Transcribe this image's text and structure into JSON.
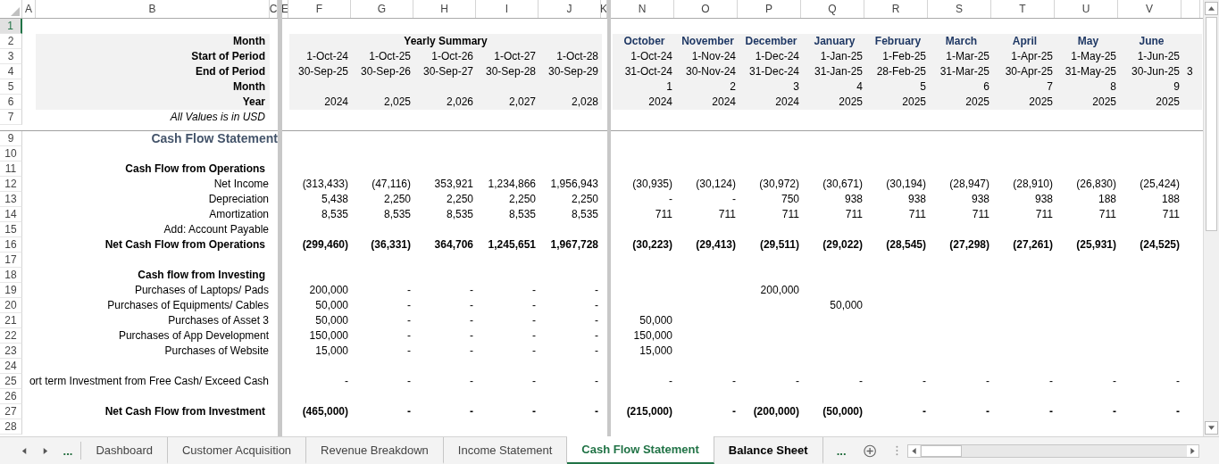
{
  "column_headers": [
    "A",
    "B",
    "C",
    "E",
    "F",
    "G",
    "H",
    "I",
    "J",
    "K",
    "N",
    "O",
    "P",
    "Q",
    "R",
    "S",
    "T",
    "U",
    "V"
  ],
  "rows": [
    {
      "number": "1",
      "kind": "blank",
      "selected": true
    },
    {
      "number": "2",
      "kind": "band_title",
      "selected": false,
      "label": "Month",
      "summary_title": "Yearly Summary",
      "monthly": [
        "October",
        "November",
        "December",
        "January",
        "February",
        "March",
        "April",
        "May",
        "June"
      ]
    },
    {
      "number": "3",
      "kind": "band",
      "selected": false,
      "label": "Start of Period",
      "summary": [
        "1-Oct-24",
        "1-Oct-25",
        "1-Oct-26",
        "1-Oct-27",
        "1-Oct-28"
      ],
      "monthly": [
        "1-Oct-24",
        "1-Nov-24",
        "1-Dec-24",
        "1-Jan-25",
        "1-Feb-25",
        "1-Mar-25",
        "1-Apr-25",
        "1-May-25",
        "1-Jun-25"
      ]
    },
    {
      "number": "4",
      "kind": "band",
      "selected": false,
      "label": "End of Period",
      "summary": [
        "30-Sep-25",
        "30-Sep-26",
        "30-Sep-27",
        "30-Sep-28",
        "30-Sep-29"
      ],
      "monthly": [
        "31-Oct-24",
        "30-Nov-24",
        "31-Dec-24",
        "31-Jan-25",
        "28-Feb-25",
        "31-Mar-25",
        "30-Apr-25",
        "31-May-25",
        "30-Jun-25"
      ],
      "cut": "3"
    },
    {
      "number": "5",
      "kind": "band",
      "selected": false,
      "label": "Month",
      "monthly": [
        "1",
        "2",
        "3",
        "4",
        "5",
        "6",
        "7",
        "8",
        "9"
      ]
    },
    {
      "number": "6",
      "kind": "band",
      "selected": false,
      "label": "Year",
      "summary": [
        "2024",
        "2,025",
        "2,026",
        "2,027",
        "2,028"
      ],
      "monthly": [
        "2024",
        "2024",
        "2024",
        "2025",
        "2025",
        "2025",
        "2025",
        "2025",
        "2025"
      ]
    },
    {
      "number": "7",
      "kind": "note",
      "selected": false,
      "label": "All Values is in USD"
    },
    {
      "number": "9",
      "kind": "section",
      "selected": false,
      "label": "Cash Flow Statement"
    },
    {
      "number": "10",
      "kind": "blank",
      "selected": false
    },
    {
      "number": "11",
      "kind": "heading",
      "selected": false,
      "label": "Cash Flow from Operations"
    },
    {
      "number": "12",
      "kind": "item",
      "selected": false,
      "label": "Net Income",
      "summary": [
        "(313,433)",
        "(47,116)",
        "353,921",
        "1,234,866",
        "1,956,943"
      ],
      "monthly": [
        "(30,935)",
        "(30,124)",
        "(30,972)",
        "(30,671)",
        "(30,194)",
        "(28,947)",
        "(28,910)",
        "(26,830)",
        "(25,424)"
      ]
    },
    {
      "number": "13",
      "kind": "item",
      "selected": false,
      "label": "Depreciation",
      "summary": [
        "5,438",
        "2,250",
        "2,250",
        "2,250",
        "2,250"
      ],
      "monthly": [
        "-",
        "-",
        "750",
        "938",
        "938",
        "938",
        "938",
        "188",
        "188"
      ]
    },
    {
      "number": "14",
      "kind": "item",
      "selected": false,
      "label": "Amortization",
      "summary": [
        "8,535",
        "8,535",
        "8,535",
        "8,535",
        "8,535"
      ],
      "monthly": [
        "711",
        "711",
        "711",
        "711",
        "711",
        "711",
        "711",
        "711",
        "711"
      ]
    },
    {
      "number": "15",
      "kind": "item",
      "selected": false,
      "label": "Add: Account Payable"
    },
    {
      "number": "16",
      "kind": "total",
      "selected": false,
      "label": "Net Cash Flow from Operations",
      "summary": [
        "(299,460)",
        "(36,331)",
        "364,706",
        "1,245,651",
        "1,967,728"
      ],
      "monthly": [
        "(30,223)",
        "(29,413)",
        "(29,511)",
        "(29,022)",
        "(28,545)",
        "(27,298)",
        "(27,261)",
        "(25,931)",
        "(24,525)"
      ]
    },
    {
      "number": "17",
      "kind": "blank",
      "selected": false
    },
    {
      "number": "18",
      "kind": "heading",
      "selected": false,
      "label": "Cash flow from Investing"
    },
    {
      "number": "19",
      "kind": "item",
      "selected": false,
      "label": "Purchases of Laptops/ Pads",
      "summary": [
        "200,000",
        "-",
        "-",
        "-",
        "-"
      ],
      "monthly": [
        {
          "kind": "blank"
        },
        {
          "kind": "blank"
        },
        {
          "kind": "amount",
          "text": "200,000"
        },
        {
          "kind": "blank"
        },
        {
          "kind": "blank"
        },
        {
          "kind": "blank"
        },
        {
          "kind": "blank"
        },
        {
          "kind": "blank"
        },
        {
          "kind": "blank"
        }
      ]
    },
    {
      "number": "20",
      "kind": "item",
      "selected": false,
      "label": "Purchases of Equipments/ Cables",
      "summary": [
        "50,000",
        "-",
        "-",
        "-",
        "-"
      ],
      "monthly": [
        {
          "kind": "blank"
        },
        {
          "kind": "blank"
        },
        {
          "kind": "blank"
        },
        {
          "kind": "amount",
          "text": "50,000"
        },
        {
          "kind": "blank"
        },
        {
          "kind": "blank"
        },
        {
          "kind": "blank"
        },
        {
          "kind": "blank"
        },
        {
          "kind": "blank"
        }
      ]
    },
    {
      "number": "21",
      "kind": "item",
      "selected": false,
      "label": "Purchases of Asset 3",
      "summary": [
        "50,000",
        "-",
        "-",
        "-",
        "-"
      ],
      "monthly": [
        {
          "kind": "amount",
          "text": "50,000"
        },
        {
          "kind": "blank"
        },
        {
          "kind": "blank"
        },
        {
          "kind": "blank"
        },
        {
          "kind": "blank"
        },
        {
          "kind": "blank"
        },
        {
          "kind": "blank"
        },
        {
          "kind": "blank"
        },
        {
          "kind": "blank"
        }
      ]
    },
    {
      "number": "22",
      "kind": "item",
      "selected": false,
      "label": "Purchases of App Development",
      "summary": [
        "150,000",
        "-",
        "-",
        "-",
        "-"
      ],
      "monthly": [
        {
          "kind": "amount",
          "text": "150,000"
        },
        {
          "kind": "blank"
        },
        {
          "kind": "blank"
        },
        {
          "kind": "blank"
        },
        {
          "kind": "blank"
        },
        {
          "kind": "blank"
        },
        {
          "kind": "blank"
        },
        {
          "kind": "blank"
        },
        {
          "kind": "blank"
        }
      ]
    },
    {
      "number": "23",
      "kind": "item",
      "selected": false,
      "label": "Purchases of Website",
      "summary": [
        "15,000",
        "-",
        "-",
        "-",
        "-"
      ],
      "monthly": [
        {
          "kind": "amount",
          "text": "15,000"
        },
        {
          "kind": "blank"
        },
        {
          "kind": "blank"
        },
        {
          "kind": "blank"
        },
        {
          "kind": "blank"
        },
        {
          "kind": "blank"
        },
        {
          "kind": "blank"
        },
        {
          "kind": "blank"
        },
        {
          "kind": "blank"
        }
      ]
    },
    {
      "number": "24",
      "kind": "blank",
      "selected": false
    },
    {
      "number": "25",
      "kind": "item",
      "selected": false,
      "label": "ort term Investment from Free Cash/ Exceed Cash",
      "summary": [
        "-",
        "-",
        "-",
        "-",
        "-"
      ],
      "monthly": [
        "-",
        "-",
        "-",
        "-",
        "-",
        "-",
        "-",
        "-",
        "-"
      ]
    },
    {
      "number": "26",
      "kind": "blank",
      "selected": false
    },
    {
      "number": "27",
      "kind": "total",
      "selected": false,
      "label": "Net Cash Flow from Investment",
      "summary": [
        "(465,000)",
        "-",
        "-",
        "-",
        "-"
      ],
      "monthly": [
        "(215,000)",
        "-",
        "(200,000)",
        "(50,000)",
        "-",
        "-",
        "-",
        "-",
        "-"
      ]
    },
    {
      "number": "28",
      "kind": "blank",
      "selected": false
    }
  ],
  "tab_bar": {
    "more_left": "...",
    "more_right": "...",
    "tabs": [
      {
        "label": "Dashboard",
        "selected": false,
        "bold": false
      },
      {
        "label": "Customer Acquisition",
        "selected": false,
        "bold": false
      },
      {
        "label": "Revenue Breakdown",
        "selected": false,
        "bold": false
      },
      {
        "label": "Income Statement",
        "selected": false,
        "bold": false
      },
      {
        "label": "Cash Flow Statement",
        "selected": true,
        "bold": true
      },
      {
        "label": "Balance Sheet",
        "selected": false,
        "bold": true
      }
    ]
  }
}
